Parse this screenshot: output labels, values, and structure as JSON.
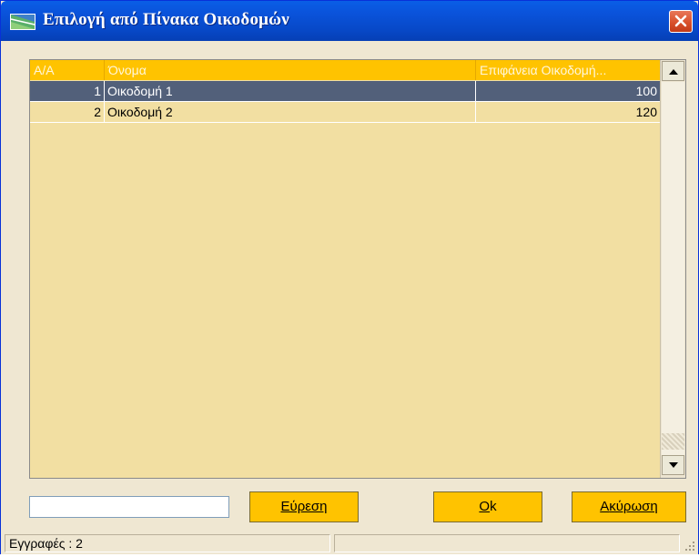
{
  "window": {
    "title": "Επιλογή από Πίνακα Οικοδομών",
    "app_icon": "table-window-icon",
    "close_icon": "close-icon"
  },
  "grid": {
    "columns": [
      {
        "label": "A/A"
      },
      {
        "label": "Όνομα"
      },
      {
        "label": "Επιφάνεια Οικοδομή..."
      }
    ],
    "rows": [
      {
        "aa": "1",
        "name": "Οικοδομή 1",
        "area": "100",
        "selected": true
      },
      {
        "aa": "2",
        "name": "Οικοδομή 2",
        "area": "120",
        "selected": false
      }
    ],
    "scroll_up_icon": "arrow-up-icon",
    "scroll_down_icon": "arrow-down-icon"
  },
  "search": {
    "value": "",
    "button_label": "Εύρεση",
    "underline_char": "Ε",
    "rest": "ύρεση"
  },
  "ok": {
    "underline_char": "O",
    "rest": "k"
  },
  "cancel": {
    "underline_char": "Α",
    "rest": "κύρωση"
  },
  "status": {
    "records": "Εγγραφές : 2",
    "secondary": ""
  },
  "colors": {
    "accent": "#ffc300",
    "grid_bg": "#f2dfa2",
    "selected_row": "#52607a",
    "titlebar": "#0a53db"
  }
}
